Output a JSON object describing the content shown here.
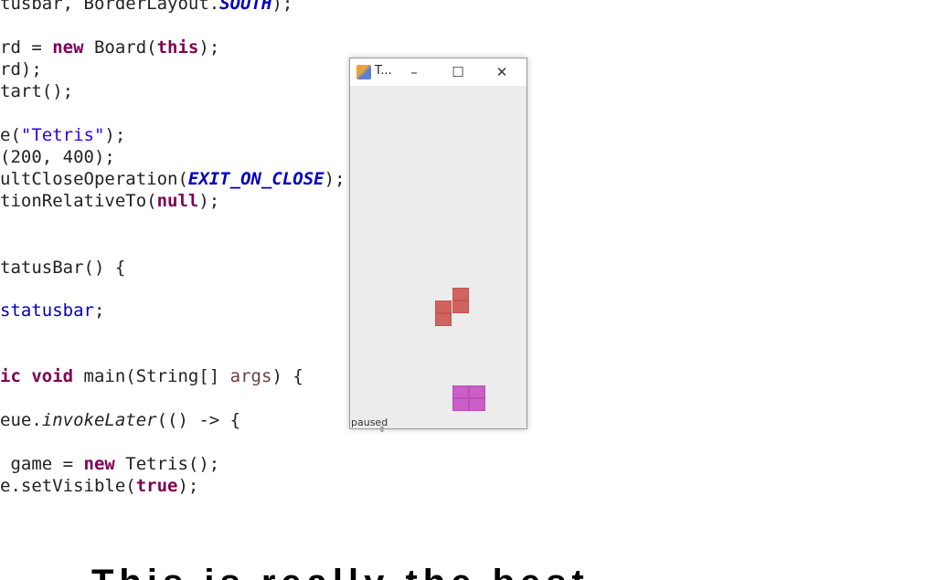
{
  "code_lines": [
    "tusbar, BorderLayout.SOUTH);",
    "rd = new Board(this);",
    "rd);",
    "tart();",
    "e(\"Tetris\");",
    "(200, 400);",
    "ultCloseOperation(EXIT_ON_CLOSE);",
    "tionRelativeTo(null);",
    "tatusBar() {",
    "statusbar;",
    "ic void main(String[] args) {",
    "eue.invokeLater(() -> {",
    " game = new Tetris();",
    "e.setVisible(true);"
  ],
  "window": {
    "title": "T...",
    "minimize": "–",
    "maximize": "☐",
    "close": "✕",
    "status": "paused"
  },
  "overlay_text": "This is really the best"
}
